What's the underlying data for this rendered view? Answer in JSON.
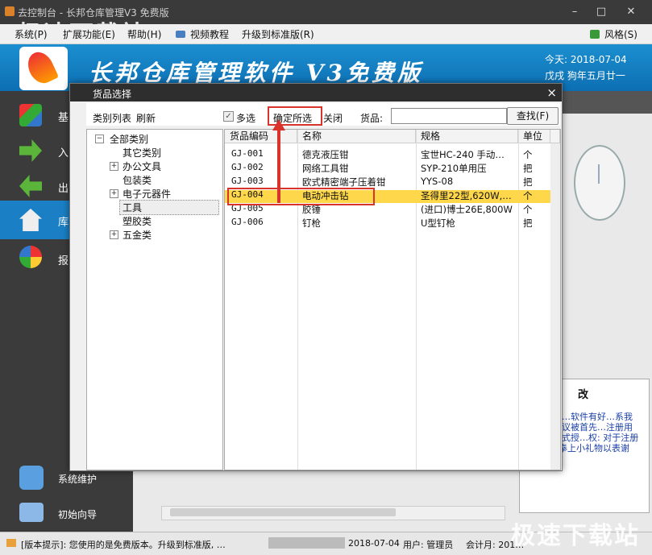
{
  "window": {
    "title": "去控制台 - 长邦仓库管理V3 免费版",
    "min_btn": "–",
    "max_btn": "□",
    "close_btn": "✕"
  },
  "menubar": {
    "items": [
      "系统(P)",
      "扩展功能(E)",
      "帮助(H)",
      "视频教程",
      "升级到标准版(R)"
    ],
    "style_label": "风格(S)"
  },
  "banner": {
    "title": "长邦仓库管理软件 V3免费版",
    "date": "今天: 2018-07-04",
    "lunar": "戊戌 狗年五月廿一"
  },
  "sidebar": {
    "items": [
      "基",
      "入",
      "出",
      "库",
      "报"
    ],
    "bottom": [
      "系统维护",
      "初始向导"
    ]
  },
  "dialog": {
    "title": "货品选择",
    "close": "×",
    "toolbar": {
      "category_list": "类别列表",
      "refresh": "刷新",
      "multi_select": "多选",
      "confirm_selected": "确定所选",
      "close": "关闭",
      "goods_label": "货品:",
      "search_value": "",
      "search_button": "查找(F)"
    },
    "tree": {
      "root": "全部类别",
      "children": [
        "其它类别",
        "办公文具",
        "包装类",
        "电子元器件",
        "工具",
        "塑胶类",
        "五金类"
      ]
    },
    "grid": {
      "headers": [
        "货品编码",
        "名称",
        "规格",
        "单位"
      ],
      "rows": [
        [
          "GJ-001",
          "德克液压钳",
          "宝世HC-240 手动…",
          "个"
        ],
        [
          "GJ-002",
          "网络工具钳",
          "SYP-210单用压",
          "把"
        ],
        [
          "GJ-003",
          "欧式精密端子压着钳",
          "YYS-08",
          "把"
        ],
        [
          "GJ-004",
          "电动冲击钻",
          "圣得里22型,620W,…",
          "个"
        ],
        [
          "GJ-005",
          "胶锤",
          "(进口)博士26E,800W",
          "个"
        ],
        [
          "GJ-006",
          "钉枪",
          "U型钉枪",
          "把"
        ]
      ]
    }
  },
  "right_panel": {
    "heading": "改",
    "text": "使用中发…软件有好…系我们。…建议被首先…注册用户…仍正式授…权: 对于注册用户, 将奉上小礼物以表谢意。"
  },
  "statusbar": {
    "hint": "[版本提示]:  您使用的是免费版本。升级到标准版, …",
    "date": "2018-07-04",
    "user": "用户: 管理员",
    "period": "会计月: 201…"
  },
  "watermark": "极速下载站",
  "colors": {
    "selection_row": "#ffd74a",
    "highlight_box": "#d9342b",
    "banner": "#1b8fd0"
  }
}
